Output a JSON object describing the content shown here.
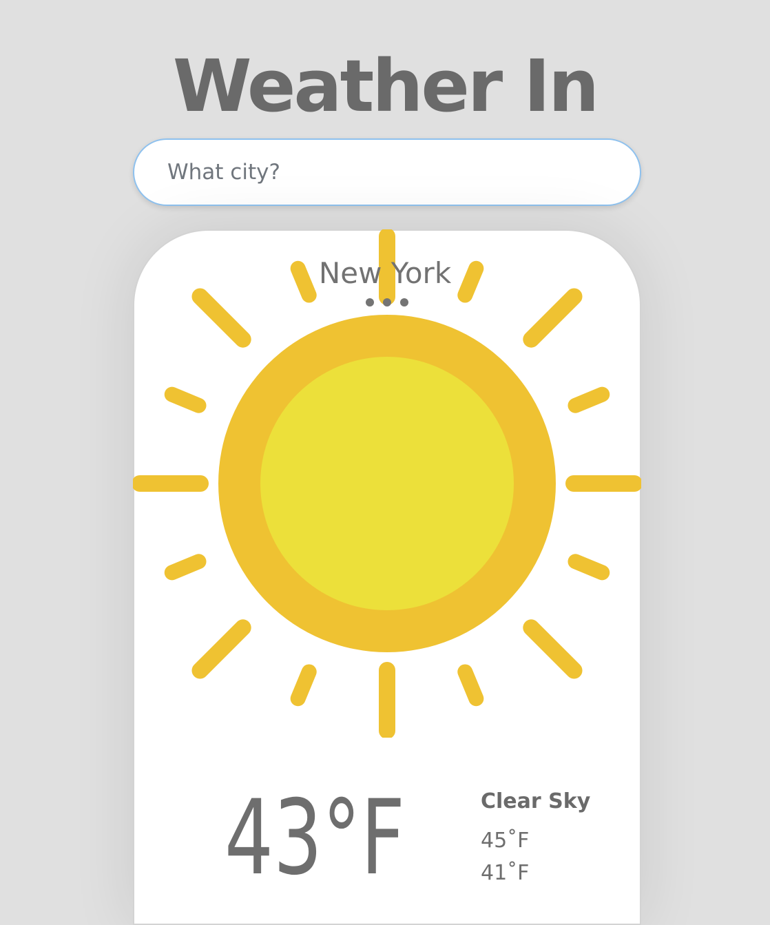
{
  "header": {
    "title": "Weather In"
  },
  "search": {
    "placeholder": "What city?",
    "value": ""
  },
  "card": {
    "city": "New York",
    "condition": "Clear Sky",
    "current_temp": "43°F",
    "high": "45˚F",
    "low": "41˚F",
    "icon": "sun-icon"
  },
  "colors": {
    "background": "#e0e0e0",
    "card": "#ffffff",
    "search_border": "#8ec1ee",
    "text": "#6e6e6e",
    "sun_outer": "#efc232",
    "sun_inner": "#ece03a",
    "sun_rays": "#efc232"
  }
}
